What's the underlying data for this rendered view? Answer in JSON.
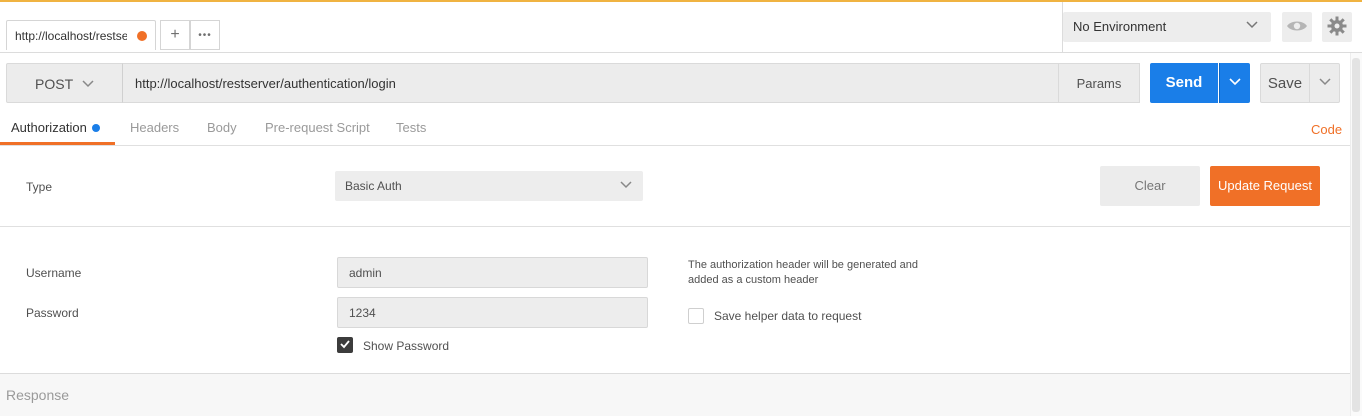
{
  "tab": {
    "title": "http://localhost/restserver/authentication/login",
    "add": "+",
    "more": "•••"
  },
  "environment": {
    "selected": "No Environment"
  },
  "request": {
    "method": "POST",
    "url": "http://localhost/restserver/authentication/login",
    "params": "Params",
    "send": "Send",
    "save": "Save"
  },
  "tabs": [
    "Authorization",
    "Headers",
    "Body",
    "Pre-request Script",
    "Tests"
  ],
  "code_link": "Code",
  "auth": {
    "type_label": "Type",
    "type_value": "Basic Auth",
    "clear": "Clear",
    "update": "Update Request",
    "username_label": "Username",
    "username_value": "admin",
    "password_label": "Password",
    "password_value": "1234",
    "show_password": "Show Password",
    "show_password_checked": true,
    "info_line1": "The authorization header will be generated and",
    "info_line2": "added as a custom header",
    "save_helper": "Save helper data to request",
    "save_helper_checked": false
  },
  "response_label": "Response",
  "colors": {
    "accent": "#f07027",
    "primary": "#1a7ee8",
    "env_border": "#f0b341"
  }
}
